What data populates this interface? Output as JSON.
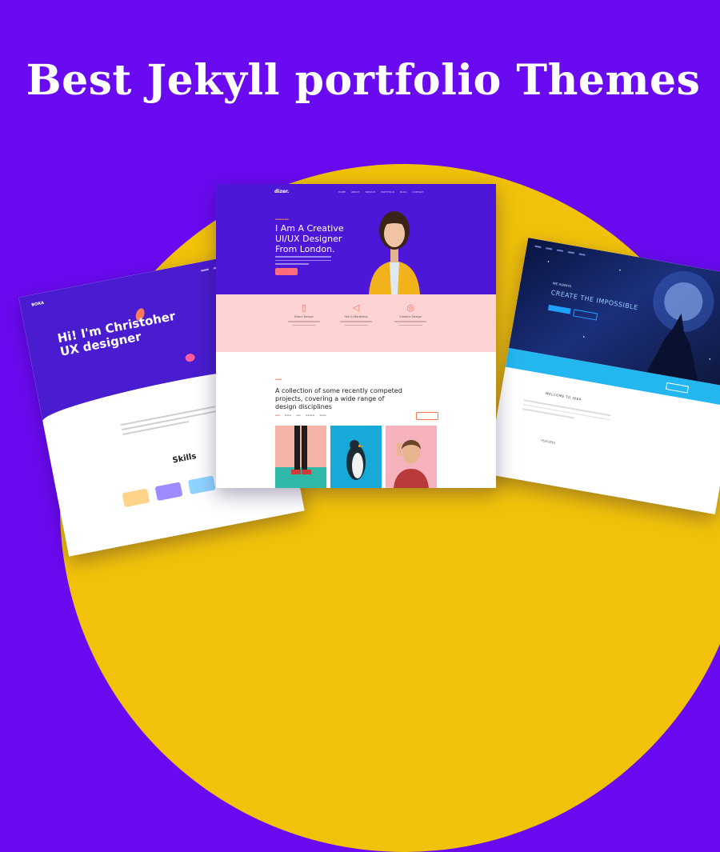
{
  "banner": {
    "title": "Best Jekyll portfolio Themes"
  },
  "colors": {
    "background": "#6a0af0",
    "accent_circle": "#f2c20a"
  },
  "left_theme": {
    "brand": "BOKA",
    "headline": "Hi! I'm Christoher UX designer",
    "section_title": "Skills"
  },
  "center_theme": {
    "brand": "dizer.",
    "nav": [
      "HOME",
      "ABOUT",
      "SERVICE",
      "PORTFOLIO",
      "BLOG",
      "CONTACT"
    ],
    "headline": "I Am A Creative UI/UX Designer From London.",
    "services": [
      {
        "icon": "document-icon",
        "label": "Brand Design"
      },
      {
        "icon": "megaphone-icon",
        "label": "Seo & Marketing"
      },
      {
        "icon": "palette-icon",
        "label": "Creative Design"
      }
    ],
    "portfolio_heading": "A collection of some recently competed projects, covering a wide range of design disciplines"
  },
  "right_theme": {
    "tagline": "WE ALWAYS",
    "hero_text": "CREATE THE IMPOSSIBLE",
    "welcome": "WELCOME TO IDEA",
    "features": "FEATURES"
  }
}
